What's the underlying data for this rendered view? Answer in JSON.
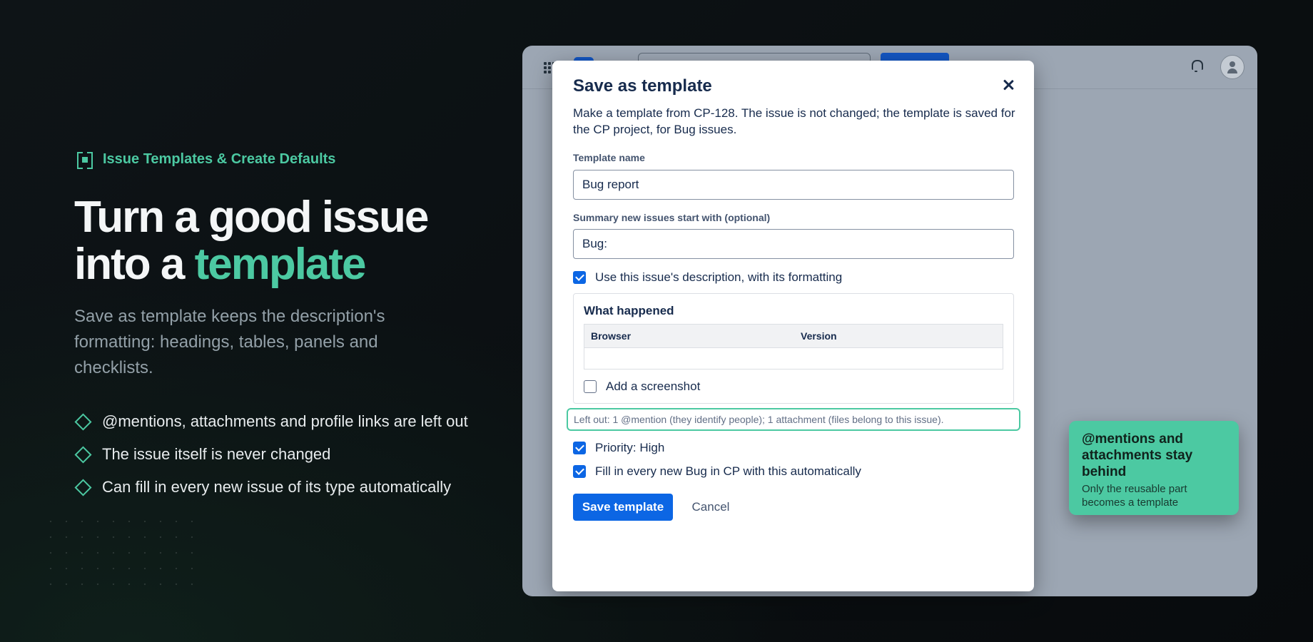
{
  "hero": {
    "eyebrow": "Issue Templates & Create Defaults",
    "title_part1": "Turn a good issue",
    "title_part2": "into a ",
    "title_accent": "template",
    "lede": "Save as template keeps the description's formatting: headings, tables, panels and checklists.",
    "bullets": [
      "@mentions, attachments and profile links are left out",
      "The issue itself is never changed",
      "Can fill in every new issue of its type automatically"
    ]
  },
  "modal": {
    "title": "Save as template",
    "intro": "Make a template from CP-128. The issue is not changed; the template is saved for the CP project, for Bug issues.",
    "template_name_label": "Template name",
    "template_name_value": "Bug report",
    "summary_label": "Summary new issues start with (optional)",
    "summary_value": "Bug:",
    "use_description": {
      "label": "Use this issue's description, with its formatting",
      "checked": true
    },
    "preview": {
      "heading": "What happened",
      "columns": [
        "Browser",
        "Version"
      ],
      "screenshot_check": {
        "label": "Add a screenshot",
        "checked": false
      }
    },
    "left_out_note": "Left out: 1 @mention (they identify people); 1 attachment (files belong to this issue).",
    "priority": {
      "label": "Priority: High",
      "checked": true
    },
    "autofill": {
      "label": "Fill in every new Bug in CP with this automatically",
      "checked": true
    },
    "save_label": "Save template",
    "cancel_label": "Cancel"
  },
  "callout": {
    "title": "@mentions and attachments stay behind",
    "subtitle": "Only the reusable part becomes a template"
  },
  "colors": {
    "accent": "#4cc9a2",
    "primary": "#0c66e4",
    "background": "#0b1013"
  }
}
